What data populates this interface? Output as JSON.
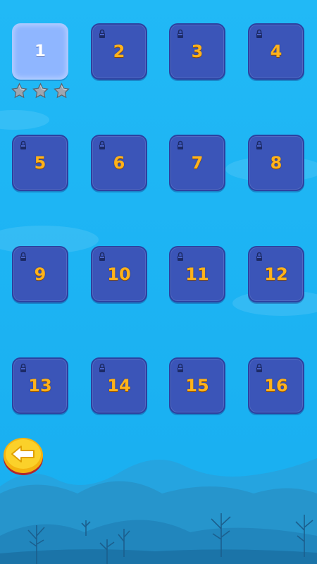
{
  "levels": [
    {
      "label": "1",
      "locked": false,
      "stars": 3
    },
    {
      "label": "2",
      "locked": true
    },
    {
      "label": "3",
      "locked": true
    },
    {
      "label": "4",
      "locked": true
    },
    {
      "label": "5",
      "locked": true
    },
    {
      "label": "6",
      "locked": true
    },
    {
      "label": "7",
      "locked": true
    },
    {
      "label": "8",
      "locked": true
    },
    {
      "label": "9",
      "locked": true
    },
    {
      "label": "10",
      "locked": true
    },
    {
      "label": "11",
      "locked": true
    },
    {
      "label": "12",
      "locked": true
    },
    {
      "label": "13",
      "locked": true
    },
    {
      "label": "14",
      "locked": true
    },
    {
      "label": "15",
      "locked": true
    },
    {
      "label": "16",
      "locked": true
    }
  ],
  "icons": {
    "lock": "lock-icon",
    "star": "star-icon",
    "back": "back-arrow-icon"
  },
  "colors": {
    "background": "#1fb8f5",
    "locked_tile": "#3b55b8",
    "unlocked_tile": "#8fb6ff",
    "number": "#ffb21a",
    "back_button": "#f7c313"
  }
}
